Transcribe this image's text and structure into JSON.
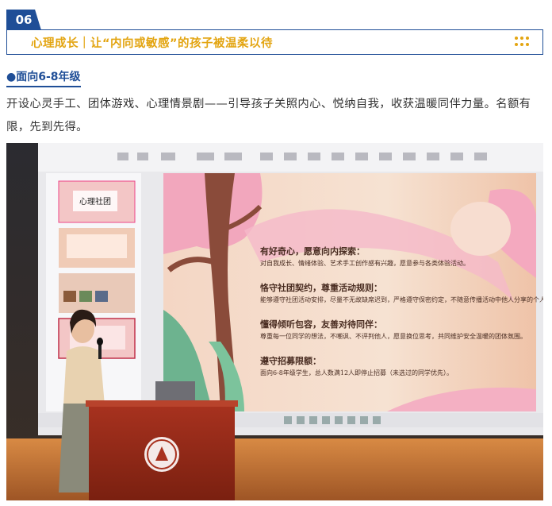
{
  "header": {
    "section_number": "06",
    "title": "心理成长｜让“内向或敏感”的孩子被温柔以待"
  },
  "subheading": "●面向6-8年级",
  "paragraph": "开设心灵手工、团体游戏、心理情景剧——引导孩子关照内心、悦纳自我，收获温暖同伴力量。名额有限，先到先得。",
  "slide": {
    "thumb_title": "心理社团",
    "items": [
      {
        "heading": "有好奇心，愿意向内探索：",
        "desc": "对自我成长、情绪体验、艺术手工创作感有兴趣，愿意参与各类体验活动。"
      },
      {
        "heading": "恪守社团契约，尊重活动规则：",
        "desc": "能够遵守社团活动安排，尽量不无故缺席迟到，严格遵守保密约定，不随意传播活动中他人分享的个人感受。"
      },
      {
        "heading": "懂得倾听包容，友善对待同伴：",
        "desc": "尊重每一位同学的想法，不嘲讽、不评判他人，愿意换位思考，共同维护安全温暖的团体氛围。"
      },
      {
        "heading": "遵守招募限额：",
        "desc": "面向6-8年级学生，总人数满12人即停止招募（未选过的同学优先）。"
      }
    ]
  },
  "colors": {
    "primary_blue": "#1f4e97",
    "accent_gold": "#e3a512",
    "text": "#333333"
  },
  "icons": [
    "dots-grid-icon"
  ]
}
